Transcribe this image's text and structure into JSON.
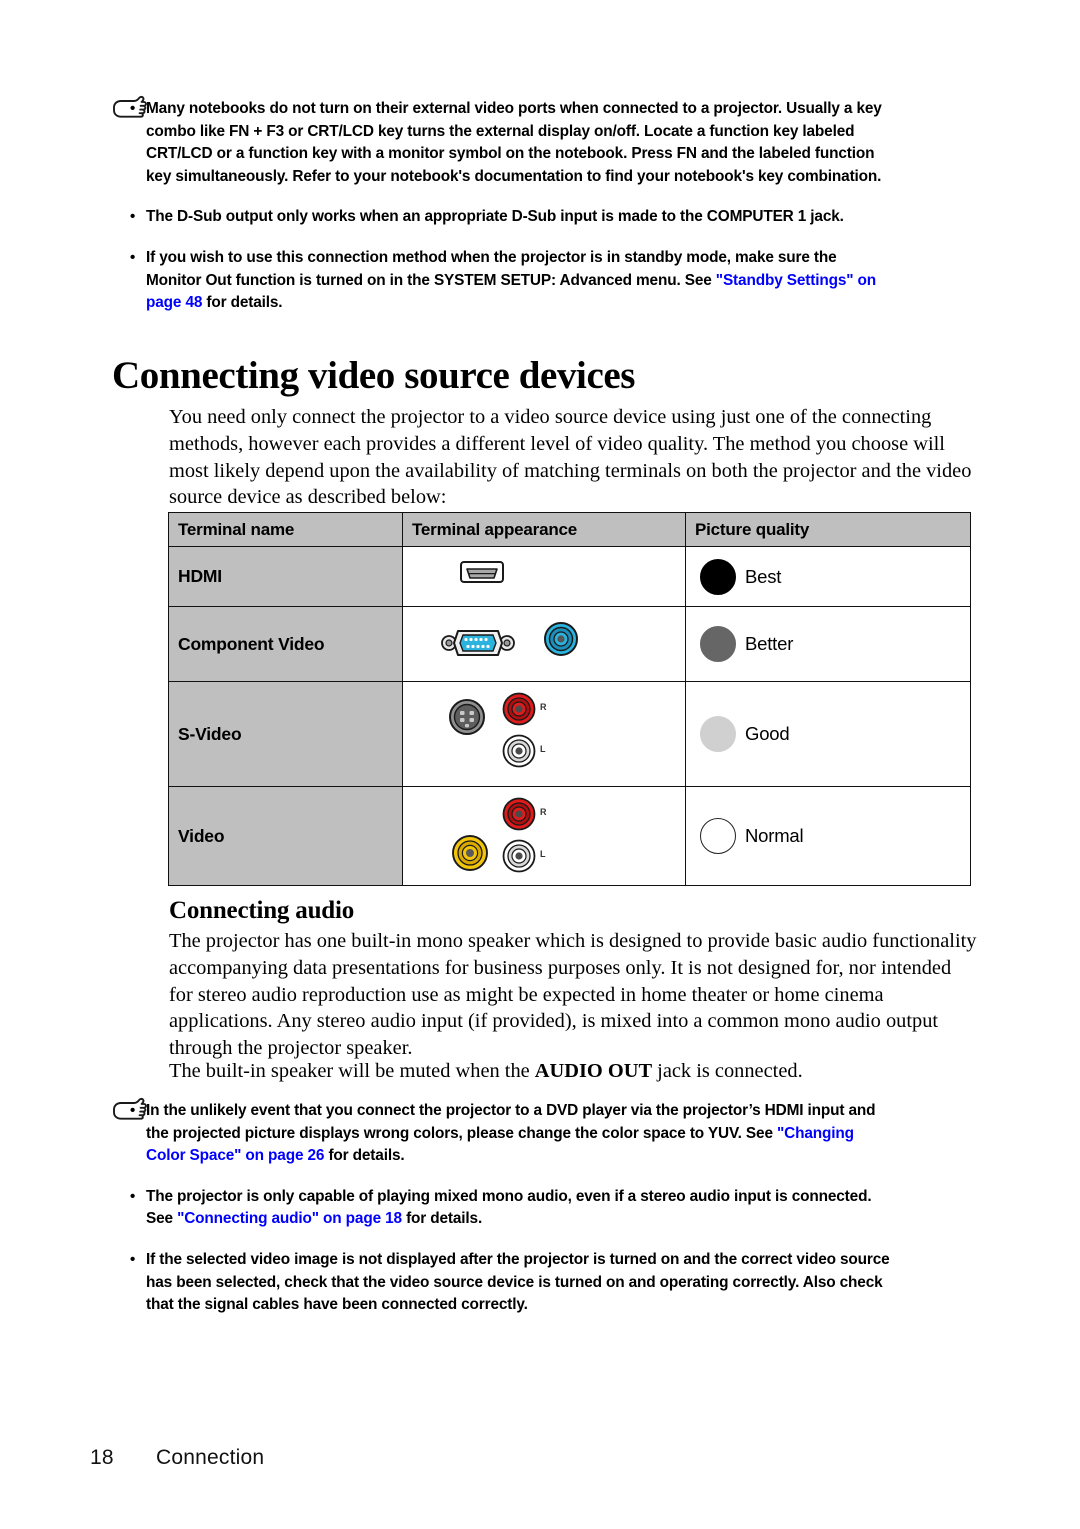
{
  "top_notes": {
    "icon": "pointing-hand-icon",
    "items": [
      {
        "bullet": "•",
        "segments": [
          {
            "text": "Many notebooks do not turn on their external video ports when connected to a projector. Usually a key combo like FN + F3 or CRT/LCD key turns the external display on/off. Locate a function key labeled CRT/LCD or a function key with a monitor symbol on the notebook. Press FN and the labeled function key simultaneously. Refer to your notebook's documentation to find your notebook's key combination.",
            "link": false
          }
        ]
      },
      {
        "bullet": "•",
        "segments": [
          {
            "text": "The D-Sub output only works when an appropriate D-Sub input is made to the COMPUTER 1 jack.",
            "link": false
          }
        ]
      },
      {
        "bullet": "•",
        "segments": [
          {
            "text": "If you wish to use this connection method when the projector is in standby mode, make sure the Monitor Out function is turned on in the SYSTEM SETUP: Advanced menu. See ",
            "link": false
          },
          {
            "text": "\"Standby Settings\" on page 48",
            "link": true
          },
          {
            "text": " for details.",
            "link": false
          }
        ]
      }
    ]
  },
  "heading": "Connecting video source devices",
  "intro_paragraph": "You need only connect the projector to a video source device using just one of the connecting methods, however each provides a different level of video quality. The method you choose will most likely depend upon the availability of matching terminals on both the projector and the video source device as described below:",
  "table": {
    "headers": [
      "Terminal name",
      "Terminal appearance",
      "Picture quality"
    ],
    "rows": [
      {
        "name": "HDMI",
        "appearance_icons": [
          "hdmi-port-icon"
        ],
        "quality_label": "Best",
        "quality_color": "#000000"
      },
      {
        "name": "Component Video",
        "appearance_icons": [
          "d-sub-vga-port-icon",
          "rca-jack-blue-icon"
        ],
        "quality_label": "Better",
        "quality_color": "#666666"
      },
      {
        "name": "S-Video",
        "appearance_icons": [
          "s-video-mini-din-port-icon",
          "rca-jack-red-icon",
          "rca-jack-white-icon"
        ],
        "quality_label": "Good",
        "quality_color": "#d0d0d0",
        "jack_labels": [
          "R",
          "L"
        ]
      },
      {
        "name": "Video",
        "appearance_icons": [
          "rca-jack-red-icon",
          "rca-jack-yellow-icon",
          "rca-jack-white-icon"
        ],
        "quality_label": "Normal",
        "quality_color": "#ffffff",
        "jack_labels": [
          "R",
          "L"
        ]
      }
    ]
  },
  "audio_section": {
    "heading": "Connecting audio",
    "paragraph1": "The projector has one built-in mono speaker which is designed to provide basic audio functionality accompanying data presentations for business purposes only. It is not designed for, nor intended for stereo audio reproduction use as might be expected in home theater or home cinema applications. Any stereo audio input (if provided), is mixed into a common mono audio output through the projector speaker.",
    "paragraph2_pre": "The built-in speaker will be muted when the ",
    "paragraph2_bold": "AUDIO OUT",
    "paragraph2_post": " jack is connected."
  },
  "bottom_notes": {
    "icon": "pointing-hand-icon",
    "items": [
      {
        "bullet": "•",
        "segments": [
          {
            "text": "In the unlikely event that you connect the projector to a DVD player via the projector’s HDMI input and the projected picture displays wrong colors, please change the color space to YUV. See ",
            "link": false
          },
          {
            "text": "\"Changing Color Space\" on page 26",
            "link": true
          },
          {
            "text": " for details.",
            "link": false
          }
        ]
      },
      {
        "bullet": "•",
        "segments": [
          {
            "text": "The projector is only capable of playing mixed mono audio, even if a stereo audio input is connected. See ",
            "link": false
          },
          {
            "text": "\"Connecting audio\" on page 18",
            "link": true
          },
          {
            "text": " for details.",
            "link": false
          }
        ]
      },
      {
        "bullet": "•",
        "segments": [
          {
            "text": "If the selected video image is not displayed after the projector is turned on and the correct video source has been selected, check that the video source device is turned on and operating correctly. Also check that the signal cables have been connected correctly.",
            "link": false
          }
        ]
      }
    ]
  },
  "footer": {
    "page_number": "18",
    "section": "Connection"
  },
  "colors": {
    "link": "#0000ff",
    "table_header_bg": "#bfbfbf",
    "table_border": "#111111",
    "connector_blue": "#2bb3e0",
    "jack_red": "#e01b1b",
    "jack_yellow": "#f2c40c"
  }
}
